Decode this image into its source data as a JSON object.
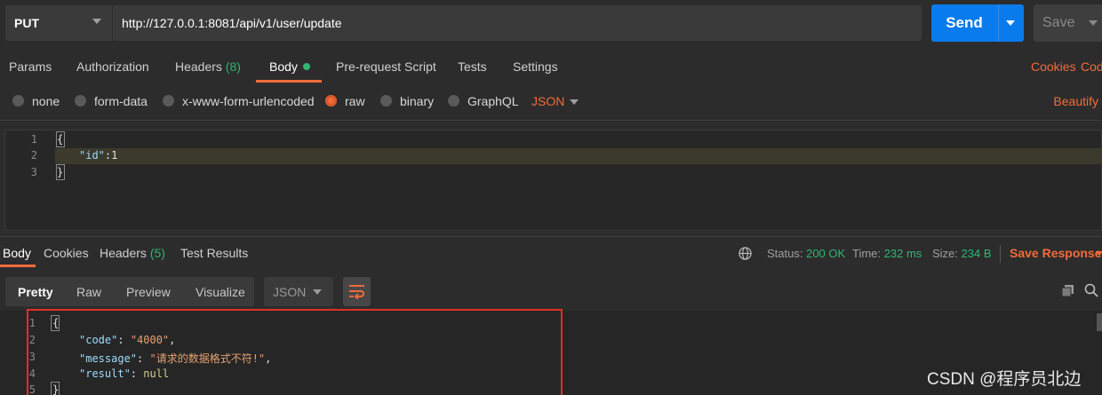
{
  "request": {
    "method": "PUT",
    "url": "http://127.0.0.1:8081/api/v1/user/update",
    "send_label": "Send",
    "save_label": "Save"
  },
  "req_tabs": {
    "params": "Params",
    "authorization": "Authorization",
    "headers": "Headers",
    "headers_count": "(8)",
    "body": "Body",
    "prerequest": "Pre-request Script",
    "tests": "Tests",
    "settings": "Settings",
    "cookies": "Cookies",
    "code": "Cod"
  },
  "body_types": {
    "none": "none",
    "form_data": "form-data",
    "urlencoded": "x-www-form-urlencoded",
    "raw": "raw",
    "binary": "binary",
    "graphql": "GraphQL",
    "selected": "raw",
    "language": "JSON",
    "beautify": "Beautify"
  },
  "request_body": {
    "line_numbers": [
      "1",
      "2",
      "3"
    ],
    "line1": "{",
    "line2_key": "\"id\"",
    "line2_rest": ":1",
    "line3": "}"
  },
  "res_tabs": {
    "body": "Body",
    "cookies": "Cookies",
    "headers": "Headers",
    "headers_count": "(5)",
    "test_results": "Test Results"
  },
  "status": {
    "status_label": "Status:",
    "status_value": "200 OK",
    "time_label": "Time:",
    "time_value": "232 ms",
    "size_label": "Size:",
    "size_value": "234 B",
    "save_response": "Save Response"
  },
  "view": {
    "pretty": "Pretty",
    "raw": "Raw",
    "preview": "Preview",
    "visualize": "Visualize",
    "format": "JSON"
  },
  "response_body": {
    "line_numbers": [
      "1",
      "2",
      "3",
      "4",
      "5"
    ],
    "open": "{",
    "code_key": "\"code\"",
    "code_val": "\"4000\"",
    "message_key": "\"message\"",
    "message_val": "\"请求的数据格式不符!\"",
    "result_key": "\"result\"",
    "result_val": "null",
    "close": "}"
  },
  "watermark": "CSDN @程序员北边",
  "colors": {
    "accent": "#f26b3a",
    "send": "#097bed",
    "success": "#2fb673",
    "highlight_box": "#e0302a"
  }
}
